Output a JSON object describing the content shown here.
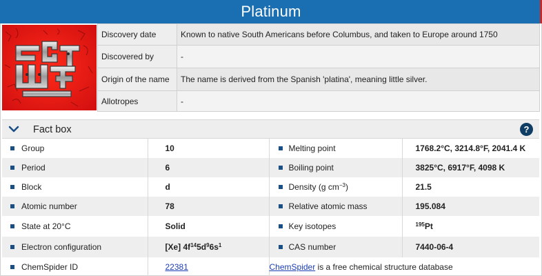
{
  "title": "Platinum",
  "image": {
    "name": "Platinum element illustration"
  },
  "overview": [
    {
      "label": "Discovery date",
      "value": "Known to native South Americans before Columbus, and taken to Europe around 1750"
    },
    {
      "label": "Discovered by",
      "value": "-"
    },
    {
      "label": "Origin of the name",
      "value": "The name is derived from the Spanish 'platina', meaning little silver."
    },
    {
      "label": "Allotropes",
      "value": "-"
    }
  ],
  "factbox": {
    "title": "Fact box",
    "help": "?",
    "left": [
      {
        "label": "Group",
        "value": "10"
      },
      {
        "label": "Period",
        "value": "6"
      },
      {
        "label": "Block",
        "value": "d"
      },
      {
        "label": "Atomic number",
        "value": "78"
      },
      {
        "label": "State at 20°C",
        "value": "Solid"
      },
      {
        "label": "Electron configuration",
        "value_prefix": "[Xe] 4f",
        "sup1": "14",
        "mid1": "5d",
        "sup2": "9",
        "mid2": "6s",
        "sup3": "1"
      },
      {
        "label": "ChemSpider ID",
        "value": "22381"
      }
    ],
    "right": [
      {
        "label": "Melting point",
        "value": "1768.2°C, 3214.8°F, 2041.4 K"
      },
      {
        "label": "Boiling point",
        "value": "3825°C, 6917°F, 4098 K"
      },
      {
        "label": "Density (g cm",
        "label_sup": "−3",
        "label_end": ")",
        "value": "21.5"
      },
      {
        "label": "Relative atomic mass",
        "value": "195.084"
      },
      {
        "label": "Key isotopes",
        "value_sup": "195",
        "value": "Pt"
      },
      {
        "label": "CAS number",
        "value": "7440-06-4"
      }
    ],
    "chemspider_link": "ChemSpider",
    "chemspider_note": " is a free chemical structure database"
  },
  "colors": {
    "title_bar": "#1a6fb3",
    "accent_red": "#e02020",
    "bullet": "#1a4f85",
    "help": "#0f3d64"
  }
}
